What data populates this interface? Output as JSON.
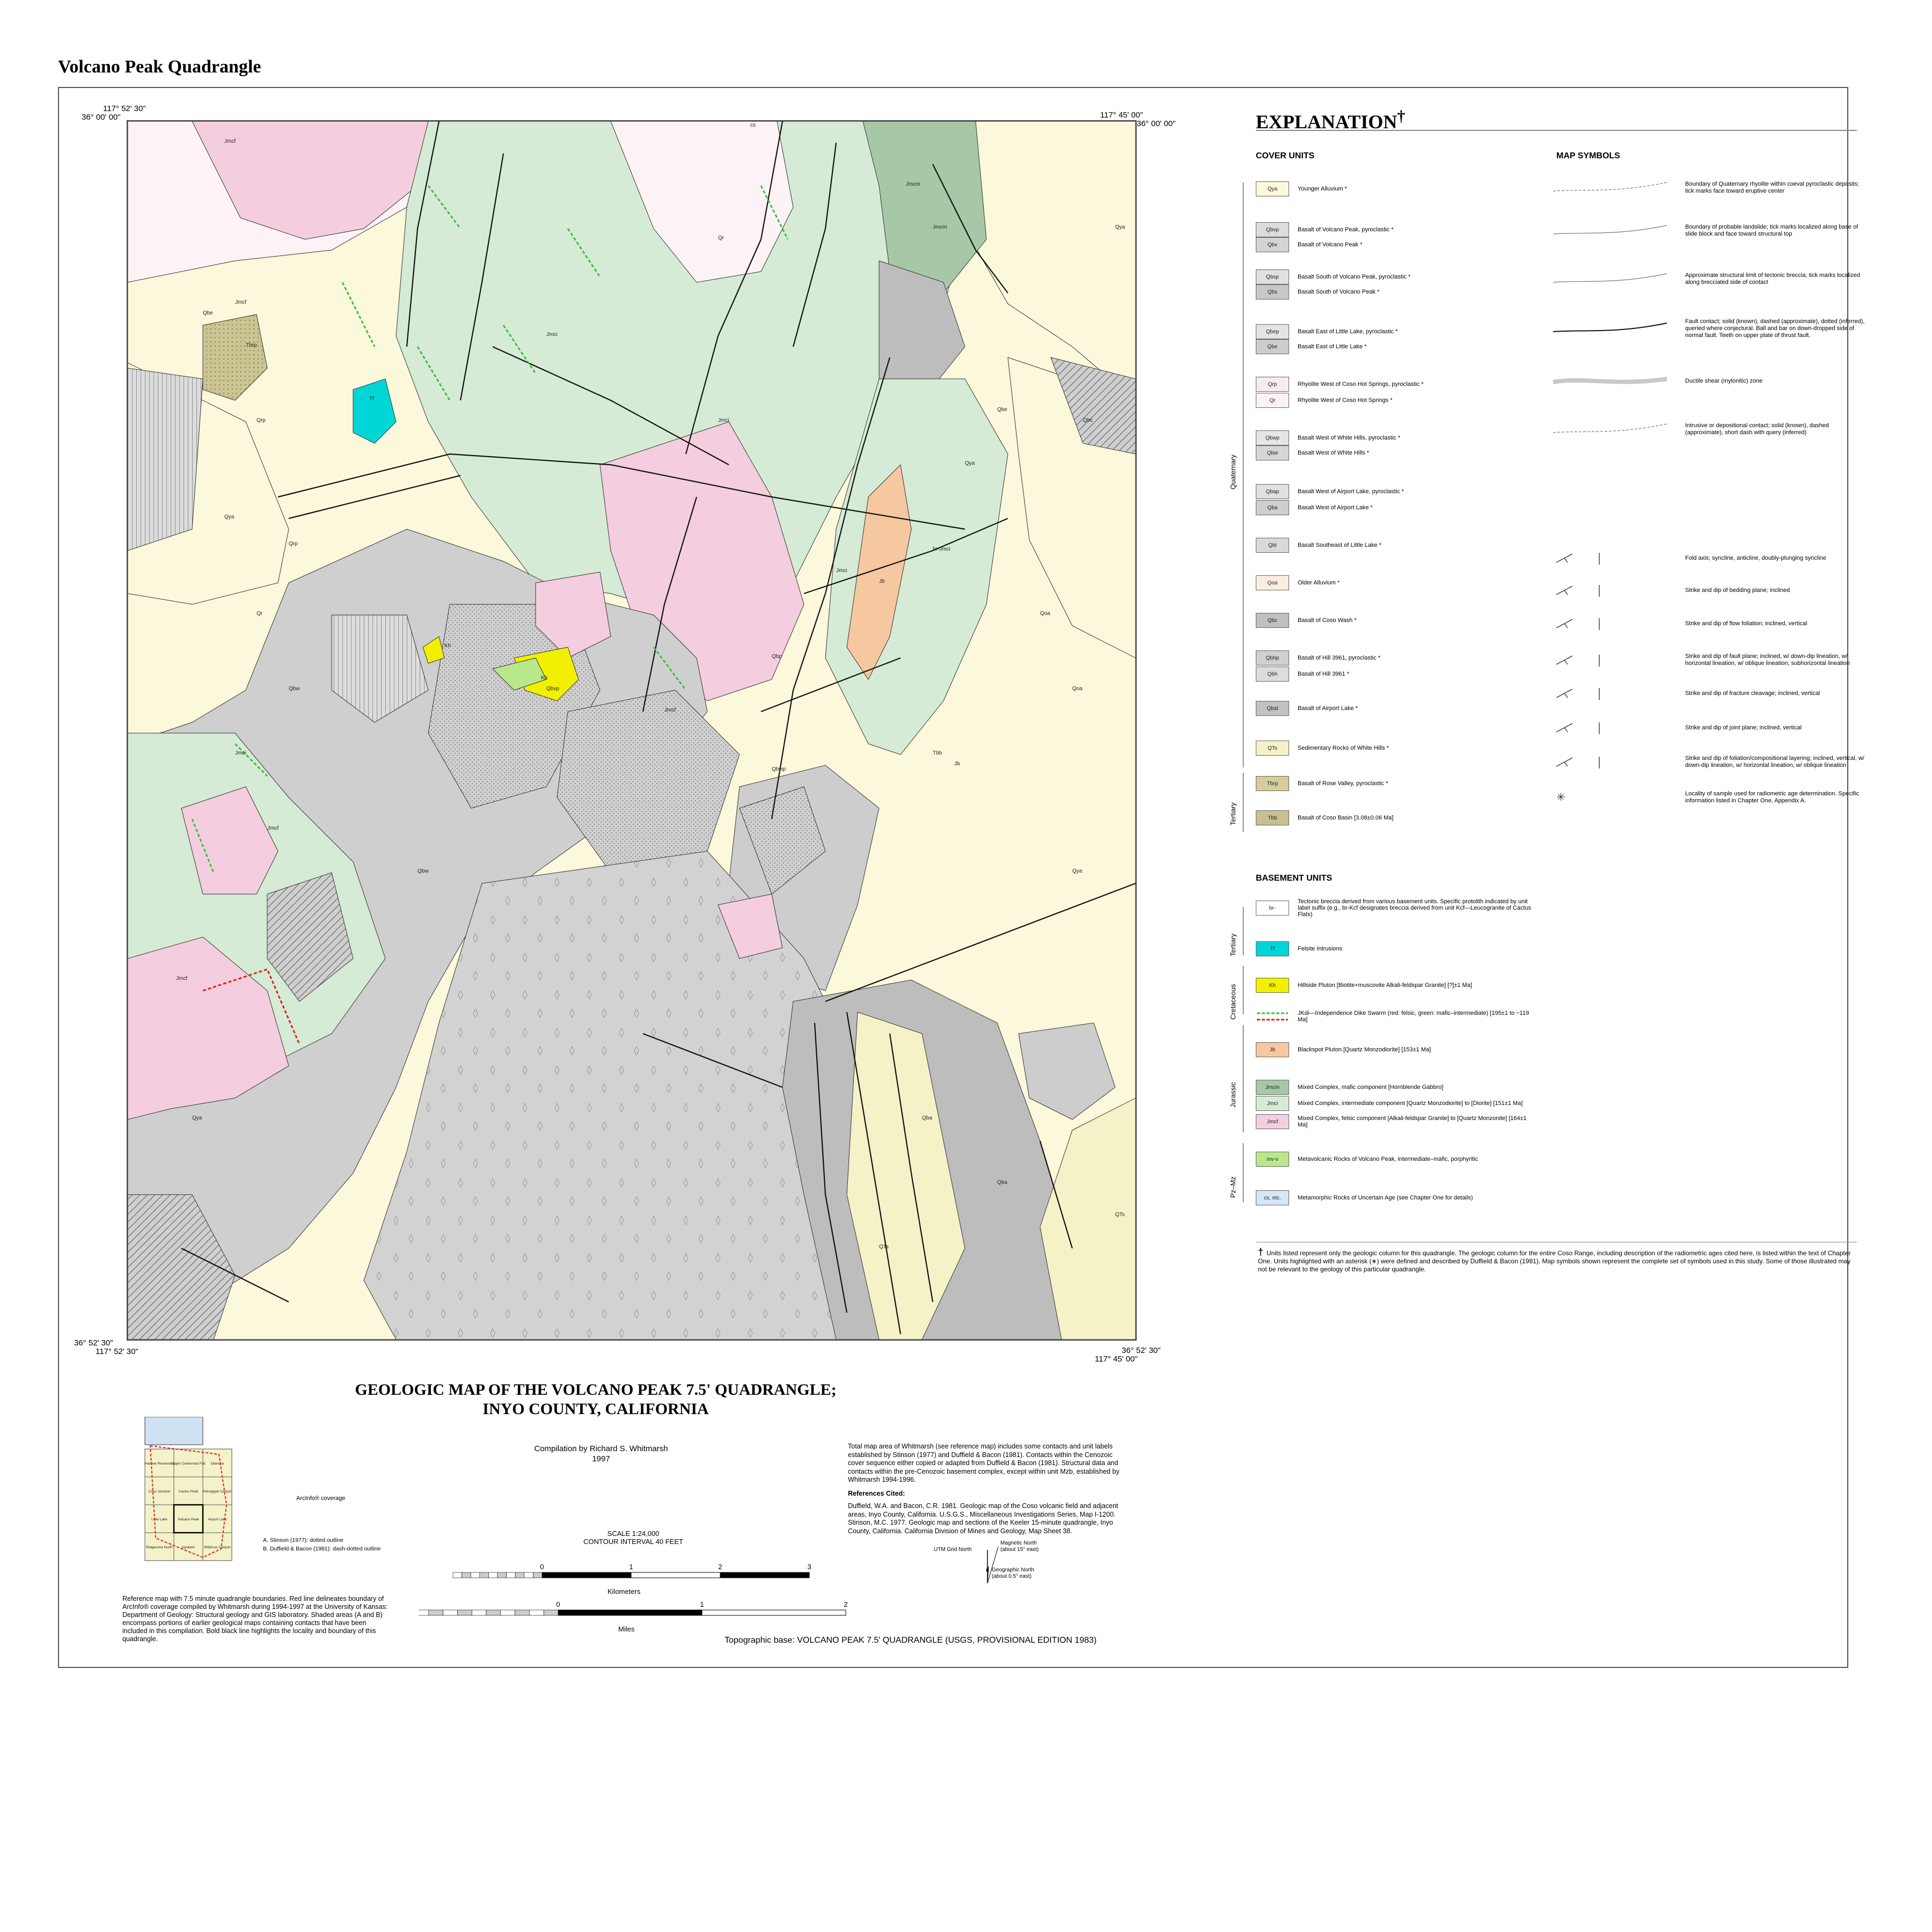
{
  "page_title": "Volcano Peak Quadrangle",
  "map_corners": {
    "nw_lon": "117° 52' 30\"",
    "nw_lat": "36° 00' 00\"",
    "ne_lon": "117° 45' 00\"",
    "ne_lat": "36° 00' 00\"",
    "sw_lat": "36° 52' 30\"",
    "sw_lon": "117° 52' 30\"",
    "se_lat": "36° 52' 30\"",
    "se_lon": "117° 45' 00\""
  },
  "map_labels": [
    "Jmcf",
    "Jmci",
    "Jmcm",
    "Qya",
    "Qoa",
    "Qbw",
    "Qbe",
    "Qba",
    "Qbp",
    "Qbvp",
    "Qbwp",
    "Qbc",
    "Qrp",
    "Qr",
    "QTs",
    "Tbrp",
    "Tbb",
    "Kh",
    "Tf",
    "Jb",
    "br-Jmci",
    "cs"
  ],
  "colors": {
    "Qya": "#fbf8dc",
    "Qoa": "#fbeede",
    "Qbvp": "#dcdcdc",
    "Qbv": "#d4d4d4",
    "Qbsp": "#e0e0e0",
    "Qbs": "#c8c8c8",
    "Qbep": "#e4e4e4",
    "Qbe": "#cdcdcd",
    "Qrp": "#f7ecec",
    "Qr": "#fdf3f6",
    "Qbwp": "#e6e6e6",
    "Qbw": "#d6d6d6",
    "Qbap": "#e0e0e0",
    "Qba": "#cfcfcf",
    "Qbl": "#d9d9d9",
    "Qbc": "#c0c0c0",
    "Qbh": "#dcdcdc",
    "Qbhp": "#d0d0d0",
    "Qbal": "#c2c2c2",
    "QTs": "#f6f2c8",
    "Tbrp": "#d4cd9c",
    "Tbb": "#c8c090",
    "br": "#ffffff",
    "Tf": "#00d6d6",
    "Kh": "#f2f000",
    "dike": "#8ed84a",
    "Jb": "#f6c8a0",
    "Jmcm": "#a6c8a6",
    "Jmci": "#d6ebd6",
    "Jmcf": "#f4cede",
    "mv": "#b8e88a",
    "cs": "#d6e6f6",
    "jmci_green_map": "#cfe6cf",
    "fault": "#111111",
    "dike_green": "#3bbf3b",
    "dike_red": "#e02020"
  },
  "explanation": {
    "title": "EXPLANATION",
    "dagger": "†",
    "cover_heading": "COVER UNITS",
    "symbols_heading": "MAP SYMBOLS",
    "basement_heading": "BASEMENT UNITS",
    "cover_units": [
      {
        "code": "Qya",
        "label": "Younger Alluvium",
        "star": "*"
      },
      {
        "code": "Qbvp",
        "label": "Basalt of Volcano Peak, pyroclastic",
        "star": "*"
      },
      {
        "code": "Qbv",
        "label": "Basalt of Volcano Peak",
        "star": "*"
      },
      {
        "code": "Qbsp",
        "label": "Basalt South of Volcano Peak, pyroclastic",
        "star": "*"
      },
      {
        "code": "Qbs",
        "label": "Basalt South of Volcano Peak",
        "star": "*"
      },
      {
        "code": "Qbep",
        "label": "Basalt East of Little Lake, pyroclastic",
        "star": "*"
      },
      {
        "code": "Qbe",
        "label": "Basalt East of Little Lake",
        "star": "*"
      },
      {
        "code": "Qrp",
        "label": "Rhyolite West of Coso Hot Springs, pyroclastic",
        "star": "*"
      },
      {
        "code": "Qr",
        "label": "Rhyolite West of Coso Hot Springs",
        "star": "*"
      },
      {
        "code": "Qbwp",
        "label": "Basalt West of White Hills, pyroclastic",
        "star": "*"
      },
      {
        "code": "Qbw",
        "label": "Basalt West of White Hills",
        "star": "*"
      },
      {
        "code": "Qbap",
        "label": "Basalt West of Airport Lake, pyroclastic",
        "star": "*"
      },
      {
        "code": "Qba",
        "label": "Basalt West of Airport Lake",
        "star": "*"
      },
      {
        "code": "Qbl",
        "label": "Basalt Southeast of Little Lake",
        "star": "*"
      },
      {
        "code": "Qoa",
        "label": "Older Alluvium",
        "star": "*"
      },
      {
        "code": "Qbc",
        "label": "Basalt of Coso Wash",
        "star": "*"
      },
      {
        "code": "Qbhp",
        "label": "Basalt of Hill 3961, pyroclastic",
        "star": "*"
      },
      {
        "code": "Qbh",
        "label": "Basalt of Hill 3961",
        "star": "*"
      },
      {
        "code": "Qbal",
        "label": "Basalt of Airport Lake",
        "star": "*"
      },
      {
        "code": "QTs",
        "label": "Sedimentary Rocks of White Hills",
        "star": "*"
      },
      {
        "code": "Tbrp",
        "label": "Basalt of Rose Valley, pyroclastic",
        "star": "*"
      },
      {
        "code": "Tbb",
        "label": "Basalt of Coso Basin [3.08±0.06 Ma]",
        "star": ""
      }
    ],
    "basement_units": [
      {
        "code": "br-",
        "label": "Tectonic breccia derived from various basement units. Specific protolith indicated by unit label suffix (e.g., br-Kcf designates breccia derived from unit Kcf—Leucogranite of Cactus Flats)"
      },
      {
        "code": "Tf",
        "label": "Felsite Intrusions"
      },
      {
        "code": "Kh",
        "label": "Hillside Pluton [Biotite+muscovite Alkali-feldspar Granite] [?]±1 Ma]"
      },
      {
        "code": "",
        "label": "JKdi—Independence Dike Swarm (red: felsic, green: mafic–intermediate) [195±1 to ~119 Ma]"
      },
      {
        "code": "Jb",
        "label": "Blackspot Pluton [Quartz Monzodiorite] [153±1 Ma]"
      },
      {
        "code": "Jmcm",
        "label": "Mixed Complex, mafic component [Hornblende Gabbro]"
      },
      {
        "code": "Jmci",
        "label": "Mixed Complex, intermediate component [Quartz Monzodiorite] to [Diorite] [151±1 Ma]"
      },
      {
        "code": "Jmcf",
        "label": "Mixed Complex, felsic component [Alkali-feldspar Granite] to [Quartz Monzonite] [164±1 Ma]"
      },
      {
        "code": "mv-v",
        "label": "Metavolcanic Rocks of Volcano Peak, intermediate–mafic, porphyritic"
      },
      {
        "code": "cs, etc.",
        "label": "Metamorphic Rocks of Uncertain Age (see Chapter One for details)"
      }
    ],
    "ages": {
      "quaternary": "Quaternary",
      "tertiary": "Tertiary",
      "cretaceous": "Cretaceous",
      "jurassic": "Jurassic",
      "pzmz": "Pz–Mz"
    },
    "map_symbols": [
      {
        "name": "eruptive-boundary",
        "label": "Boundary of Quaternary rhyolite within coeval pyroclastic deposits; tick marks face toward eruptive center"
      },
      {
        "name": "landslide-boundary",
        "label": "Boundary of probable landslide; tick marks localized along base of slide block and face toward structural top"
      },
      {
        "name": "breccia-limit",
        "label": "Approximate structural limit of tectonic breccia; tick marks localized along brecciated side of contact"
      },
      {
        "name": "fault-contact",
        "label": "Fault contact; solid (known), dashed (approximate), dotted (inferred), queried where conjectural. Ball and bar on down-dropped side of normal fault. Teeth on upper plate of thrust fault."
      },
      {
        "name": "ductile-shear",
        "label": "Ductile shear (mylonitic) zone"
      },
      {
        "name": "intrusive-contact",
        "label": "Intrusive or depositional contact; solid (known), dashed (approximate), short dash with query (inferred)"
      },
      {
        "name": "fold-axis",
        "label": "Fold axis; syncline, anticline, doubly-plunging syncline"
      },
      {
        "name": "bedding",
        "label": "Strike and dip of bedding plane; inclined"
      },
      {
        "name": "flow-foliation",
        "label": "Strike and dip of flow foliation; inclined, vertical"
      },
      {
        "name": "fault-plane",
        "label": "Strike and dip of fault plane; inclined, w/ down-dip lineation, w/ horizontal lineation, w/ oblique lineation; subhorizontal lineation"
      },
      {
        "name": "fracture-cleavage",
        "label": "Strike and dip of fracture cleavage; inclined, vertical"
      },
      {
        "name": "joint-plane",
        "label": "Strike and dip of joint plane; inclined, vertical"
      },
      {
        "name": "foliation",
        "label": "Strike and dip of foliation/compositional layering; inclined, vertical, w/ down-dip lineation, w/ horizontal lineation, w/ oblique lineation"
      },
      {
        "name": "sample-locality",
        "label": "Locality of sample used for radiometric age determination. Specific information listed in Chapter One, Appendix A."
      }
    ],
    "footnote": "Units listed represent only the geologic column for this quadrangle. The geologic column for the entire Coso Range, including description of the radiometric ages cited here, is listed within the text of Chapter One. Units highlighted with an asterisk (∗) were defined and described by Duffield & Bacon (1981). Map symbols shown represent the complete set of symbols used in this study. Some of those illustrated may not be relevant to the geology of this particular quadrangle."
  },
  "main_title_1": "GEOLOGIC MAP OF THE VOLCANO PEAK 7.5' QUADRANGLE;",
  "main_title_2": "INYO COUNTY, CALIFORNIA",
  "compilation_1": "Compilation by Richard S. Whitmarsh",
  "compilation_2": "1997",
  "notes_text": "Total map area of Whitmarsh (see reference map) includes some contacts and unit labels established by Stinson (1977) and Duffield & Bacon (1981). Contacts within the Cenozoic cover sequence either copied or adapted from Duffield & Bacon (1981). Structural data and contacts within the pre-Cenozoic basement complex, except within unit Mzb, established by Whitmarsh 1994-1996.",
  "references_heading": "References Cited:",
  "references": [
    "Duffield, W.A. and Bacon, C.R. 1981. Geologic map of the Coso volcanic field and adjacent areas, Inyo County, California. U.S.G.S., Miscellaneous Investigations Series, Map I-1200.",
    "Stinson, M.C. 1977. Geologic map and sections of the Keeler 15-minute quadrangle, Inyo County, California. California Division of Mines and Geology, Map Sheet 38."
  ],
  "reference_map": {
    "cells": [
      "Haiwee Reservoirs",
      "Upper Centennial Flat",
      "Olancha",
      "Coso Junction",
      "Cactus Peak",
      "Petroglyph Canyon",
      "Little Lake",
      "Volcano Peak",
      "Airport Lake",
      "Ridgecrest North",
      "Inyokern",
      "Wildrose Canyon"
    ],
    "coverage_label": "ArcInfo® coverage",
    "legend_a": "A. Stinson (1977): dotted outline",
    "legend_b": "B. Duffield & Bacon (1981): dash-dotted outline",
    "caption": "Reference map with 7.5 minute quadrangle boundaries. Red line delineates boundary of ArcInfo® coverage compiled by Whitmarsh during 1994-1997 at the University of Kansas: Department of Geology: Structural geology and GIS laboratory. Shaded areas (A and B) encompass portions of earlier geological maps containing contacts that have been included in this compilation. Bold black line highlights the locality and boundary of this quadrangle."
  },
  "scale": {
    "ratio": "SCALE 1:24,000",
    "contour": "CONTOUR INTERVAL 40 FEET",
    "km_ticks": [
      "0",
      "1",
      "2",
      "3"
    ],
    "km_label": "Kilometers",
    "mi_ticks": [
      "0",
      "1",
      "2"
    ],
    "mi_label": "Miles"
  },
  "north": {
    "utm": "UTM Grid North",
    "magnetic": "Magnetic North",
    "magnetic_note": "(about 15° east)",
    "geographic": "Geographic North",
    "geographic_note": "(about 0.5° east)"
  },
  "topo_base": "Topographic base: VOLCANO PEAK 7.5' QUADRANGLE (USGS, PROVISIONAL EDITION 1983)"
}
